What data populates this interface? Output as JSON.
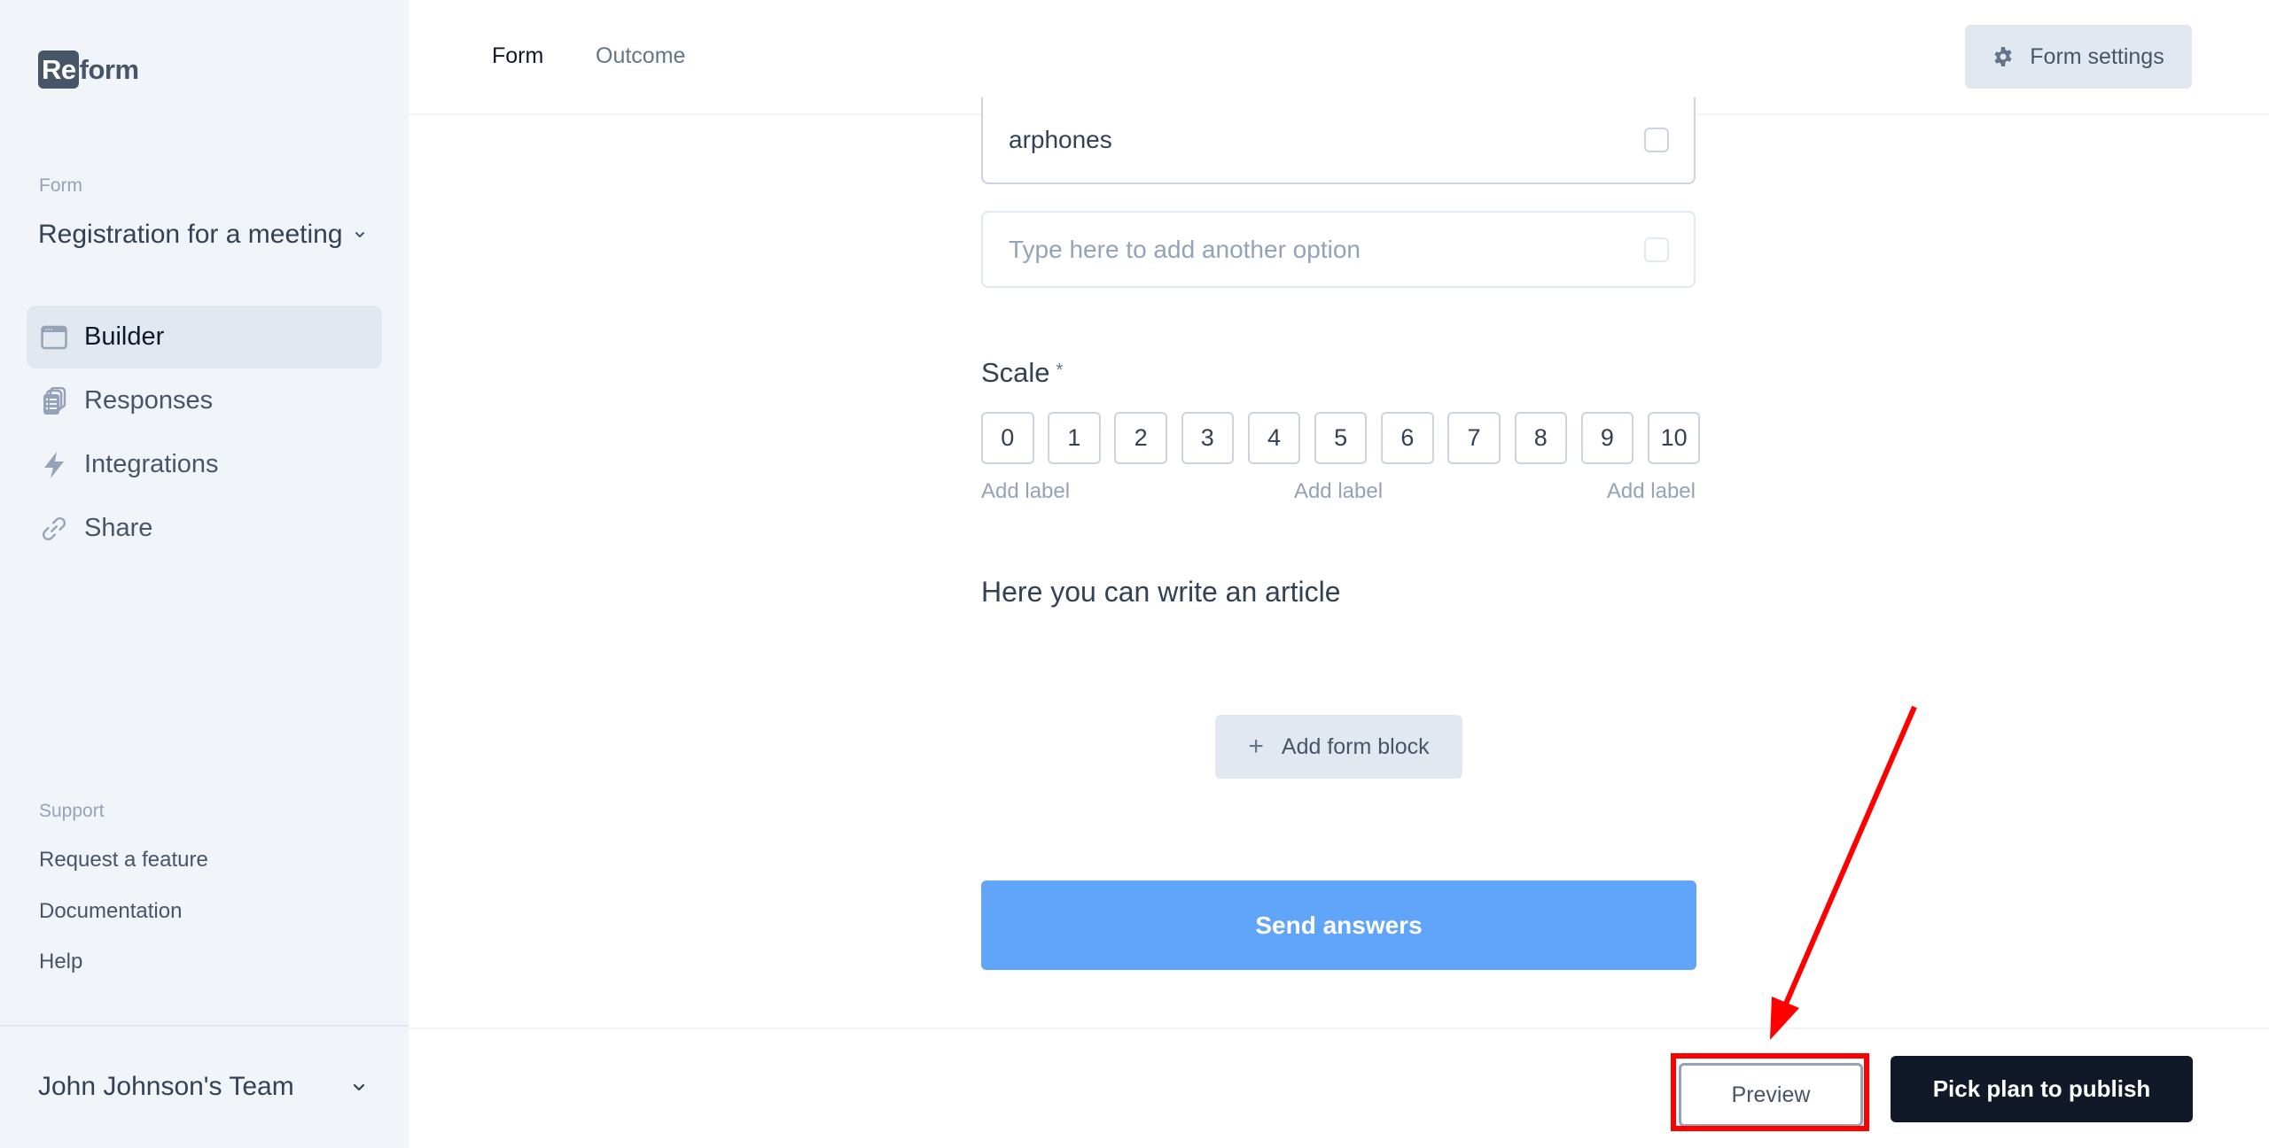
{
  "app": {
    "logo_mark": "Re",
    "logo_text": "form"
  },
  "sidebar": {
    "form_section_label": "Form",
    "form_name": "Registration for a meeting",
    "nav": [
      {
        "label": "Builder",
        "icon": "browser-window-icon",
        "active": true
      },
      {
        "label": "Responses",
        "icon": "documents-icon",
        "active": false
      },
      {
        "label": "Integrations",
        "icon": "lightning-icon",
        "active": false
      },
      {
        "label": "Share",
        "icon": "link-icon",
        "active": false
      }
    ],
    "support_label": "Support",
    "support_links": [
      "Request a feature",
      "Documentation",
      "Help"
    ],
    "team_name": "John Johnson's Team"
  },
  "header": {
    "tabs": [
      {
        "label": "Form",
        "active": true
      },
      {
        "label": "Outcome",
        "active": false
      }
    ],
    "settings_button": "Form settings"
  },
  "builder": {
    "options": [
      {
        "value": "arphones"
      }
    ],
    "new_option_placeholder": "Type here to add another option",
    "scale": {
      "title": "Scale",
      "required_mark": "*",
      "values": [
        "0",
        "1",
        "2",
        "3",
        "4",
        "5",
        "6",
        "7",
        "8",
        "9",
        "10"
      ],
      "labels": [
        "Add label",
        "Add label",
        "Add label"
      ]
    },
    "article_text": "Here you can write an article",
    "add_block_button": "Add form block",
    "submit_button": "Send answers"
  },
  "footer": {
    "preview_button": "Preview",
    "publish_button": "Pick plan to publish"
  },
  "colors": {
    "sidebar_bg": "#f1f5f9",
    "accent_blue": "#60a5fa",
    "publish_dark": "#111827",
    "annotation_red": "#ff0000"
  }
}
